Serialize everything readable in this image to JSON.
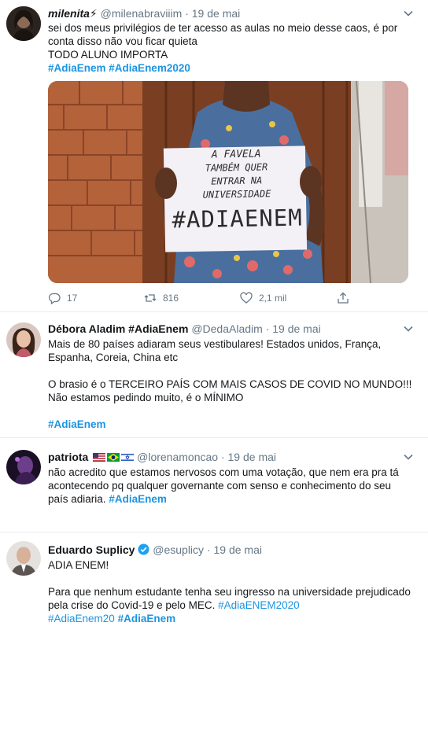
{
  "tweets": [
    {
      "name": "milenita⚡",
      "handle": "@milenabraviiim",
      "sep": "·",
      "date": "19 de mai",
      "lines": [
        "sei dos meus privilégios de ter acesso as aulas no meio desse caos, é por",
        "conta disso não vou ficar quieta",
        "TODO ALUNO IMPORTA"
      ],
      "hashtags": [
        "#AdiaEnem",
        "#AdiaEnem2020"
      ],
      "sign_lines": [
        "A FAVELA",
        "TAMBÉM QUER",
        "ENTRAR NA",
        "UNIVERSIDADE",
        "#ADIAENEM"
      ],
      "replies": "17",
      "retweets": "816",
      "likes": "2,1 mil"
    },
    {
      "name": "Débora Aladim #AdiaEnem",
      "handle": "@DedaAladim",
      "sep": "·",
      "date": "19 de mai",
      "lines": [
        "Mais de 80 países adiaram seus vestibulares! Estados unidos, França,",
        "Espanha, Coreia, China etc",
        "",
        "O brasio é o TERCEIRO PAÍS COM MAIS CASOS DE COVID NO MUNDO!!!",
        "Não estamos pedindo muito, é o MÍNIMO",
        ""
      ],
      "hashtag": "#AdiaEnem"
    },
    {
      "name": "patriota",
      "handle": "@lorenamoncao",
      "sep": "·",
      "date": "19 de mai",
      "lines": [
        "não acredito que estamos nervosos com uma votação, que nem era pra tá",
        "acontecendo pq qualquer governante com senso e conhecimento do seu",
        "país adiaria."
      ],
      "hashtag": "#AdiaEnem"
    },
    {
      "name": "Eduardo Suplicy",
      "handle": "@esuplicy",
      "sep": "·",
      "date": "19 de mai",
      "lines": [
        "ADIA ENEM!",
        "",
        "Para que nenhum estudante tenha seu ingresso na universidade prejudicado"
      ],
      "line4_prefix": "pela crise do Covid-19 e pelo MEC.",
      "line4_link": "#AdiaENEM2020",
      "line5_link": "#AdiaEnem20",
      "line5_tag": "#AdiaEnem"
    }
  ],
  "colors": {
    "accent": "#1b95e0",
    "muted": "#657786",
    "text": "#14171a",
    "verified": "#1da1f2"
  }
}
